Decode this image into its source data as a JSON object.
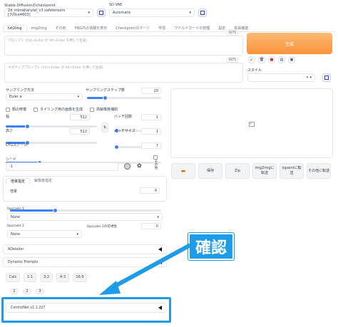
{
  "checkpoint": {
    "label": "Stable Diffusionのcheckpoint",
    "value": "2d_mimaharutal_v3.safetensors [7c0ce4603]"
  },
  "vae": {
    "label": "SD VAE",
    "value": "Automatic"
  },
  "tabs": [
    "txt2img",
    "img2img",
    "その他",
    "PNG内の情報を表示",
    "Checkpointのマージ",
    "学習",
    "ワイルドカードの管理",
    "設定",
    "拡張機能"
  ],
  "prompt": {
    "placeholder": "プロンプト (Ctrl+Enter か Alt+Enter を押して生成)",
    "count": "0/75"
  },
  "negative": {
    "placeholder": "ネガティブプロンプト (Ctrl+Enter か Alt+Enter を押して生成)",
    "count": "0/75"
  },
  "generate_label": "生成",
  "style_label": "スタイル",
  "sampler": {
    "label": "サンプリング方法",
    "value": "Euler a"
  },
  "steps": {
    "label": "サンプリングステップ数",
    "value": "20"
  },
  "checkboxes": [
    "顔の修復",
    "タイリング用の画像を生成",
    "高解像度補助"
  ],
  "width": {
    "label": "幅",
    "value": "512"
  },
  "height": {
    "label": "高さ",
    "value": "512"
  },
  "batch_count": {
    "label": "バッチ回数",
    "value": "1"
  },
  "batch_size": {
    "label": "バッチサイズ",
    "value": "1"
  },
  "cfg": {
    "label": "CFGスケール",
    "value": "7"
  },
  "seed": {
    "label": "シード",
    "value": "-1"
  },
  "extra_label": "その他",
  "hires_tabs": [
    "倍率指定",
    "解像度指定"
  ],
  "scale": {
    "label": "倍率",
    "value": "4"
  },
  "upscaler1": {
    "label": "Upscaler 1",
    "value": "None"
  },
  "upscaler2": {
    "label": "Upscaler 2",
    "value": "None"
  },
  "upscaler2_vis": {
    "label": "Upscaler 2の可視性",
    "value": "0"
  },
  "adetailer": "ADetailer",
  "dynamic_prompts": "Dynamic Prompts",
  "ratio_buttons": [
    "Calc",
    "1:1",
    "3:2",
    "4:3",
    "16:9"
  ],
  "page_dots": [
    "1",
    "2",
    "3"
  ],
  "controlnet": "ControlNet v1.1.227",
  "output_buttons": [
    "保存",
    "Zip",
    "img2imgに転送",
    "inpaintに転送",
    "その他に転送"
  ],
  "annotation": "確認",
  "colors": {
    "accent": "#3b82f6",
    "highlight": "#1e9be9",
    "generate": "#fb923c"
  }
}
